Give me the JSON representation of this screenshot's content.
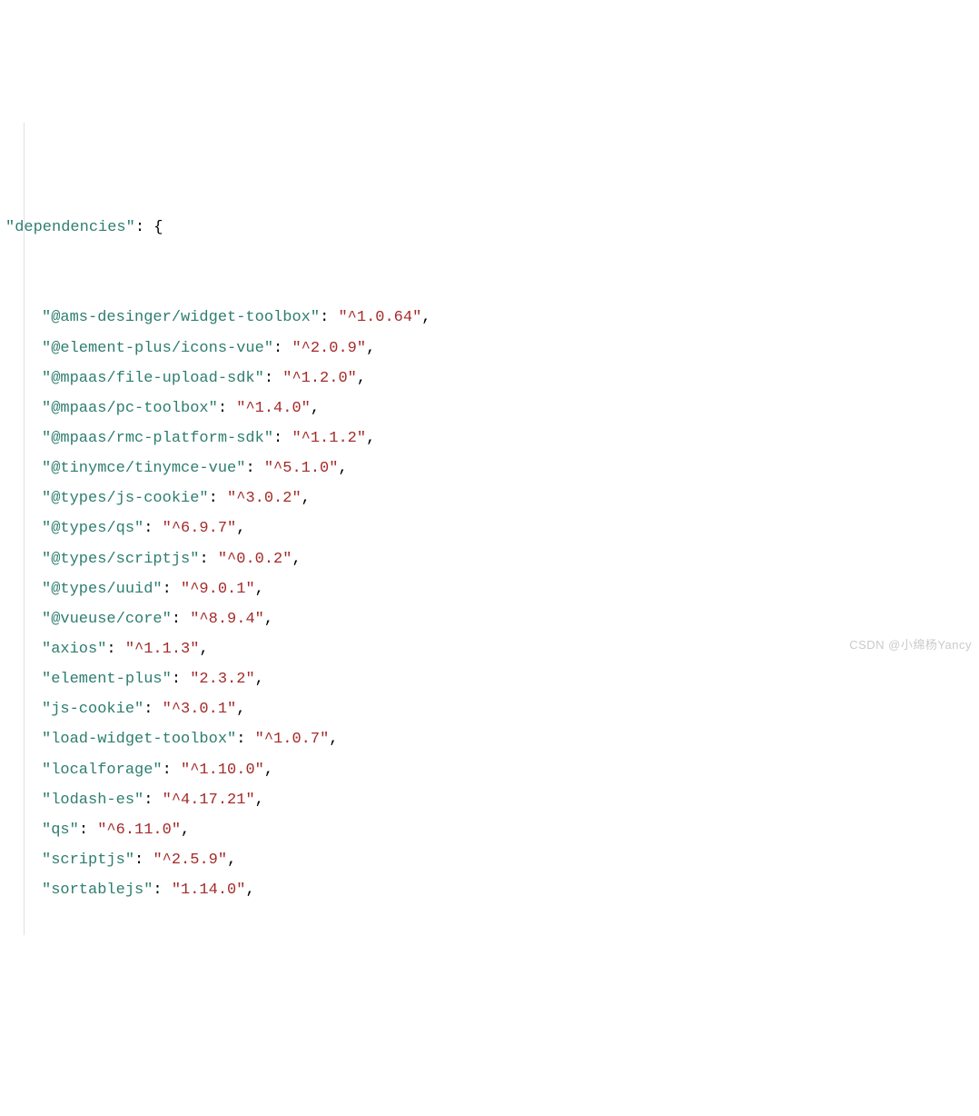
{
  "header": {
    "key": "\"dependencies\"",
    "colon": ": ",
    "brace": "{"
  },
  "entries": [
    {
      "key": "\"@ams-desinger/widget-toolbox\"",
      "value": "\"^1.0.64\""
    },
    {
      "key": "\"@element-plus/icons-vue\"",
      "value": "\"^2.0.9\""
    },
    {
      "key": "\"@mpaas/file-upload-sdk\"",
      "value": "\"^1.2.0\""
    },
    {
      "key": "\"@mpaas/pc-toolbox\"",
      "value": "\"^1.4.0\""
    },
    {
      "key": "\"@mpaas/rmc-platform-sdk\"",
      "value": "\"^1.1.2\""
    },
    {
      "key": "\"@tinymce/tinymce-vue\"",
      "value": "\"^5.1.0\""
    },
    {
      "key": "\"@types/js-cookie\"",
      "value": "\"^3.0.2\""
    },
    {
      "key": "\"@types/qs\"",
      "value": "\"^6.9.7\""
    },
    {
      "key": "\"@types/scriptjs\"",
      "value": "\"^0.0.2\""
    },
    {
      "key": "\"@types/uuid\"",
      "value": "\"^9.0.1\""
    },
    {
      "key": "\"@vueuse/core\"",
      "value": "\"^8.9.4\""
    },
    {
      "key": "\"axios\"",
      "value": "\"^1.1.3\""
    },
    {
      "key": "\"element-plus\"",
      "value": "\"2.3.2\""
    },
    {
      "key": "\"js-cookie\"",
      "value": "\"^3.0.1\""
    },
    {
      "key": "\"load-widget-toolbox\"",
      "value": "\"^1.0.7\""
    },
    {
      "key": "\"localforage\"",
      "value": "\"^1.10.0\""
    },
    {
      "key": "\"lodash-es\"",
      "value": "\"^4.17.21\""
    },
    {
      "key": "\"qs\"",
      "value": "\"^6.11.0\""
    },
    {
      "key": "\"scriptjs\"",
      "value": "\"^2.5.9\""
    },
    {
      "key": "\"sortablejs\"",
      "value": "\"1.14.0\""
    }
  ],
  "sep": ": ",
  "tail": ",",
  "watermark": "CSDN @小绵杨Yancy"
}
